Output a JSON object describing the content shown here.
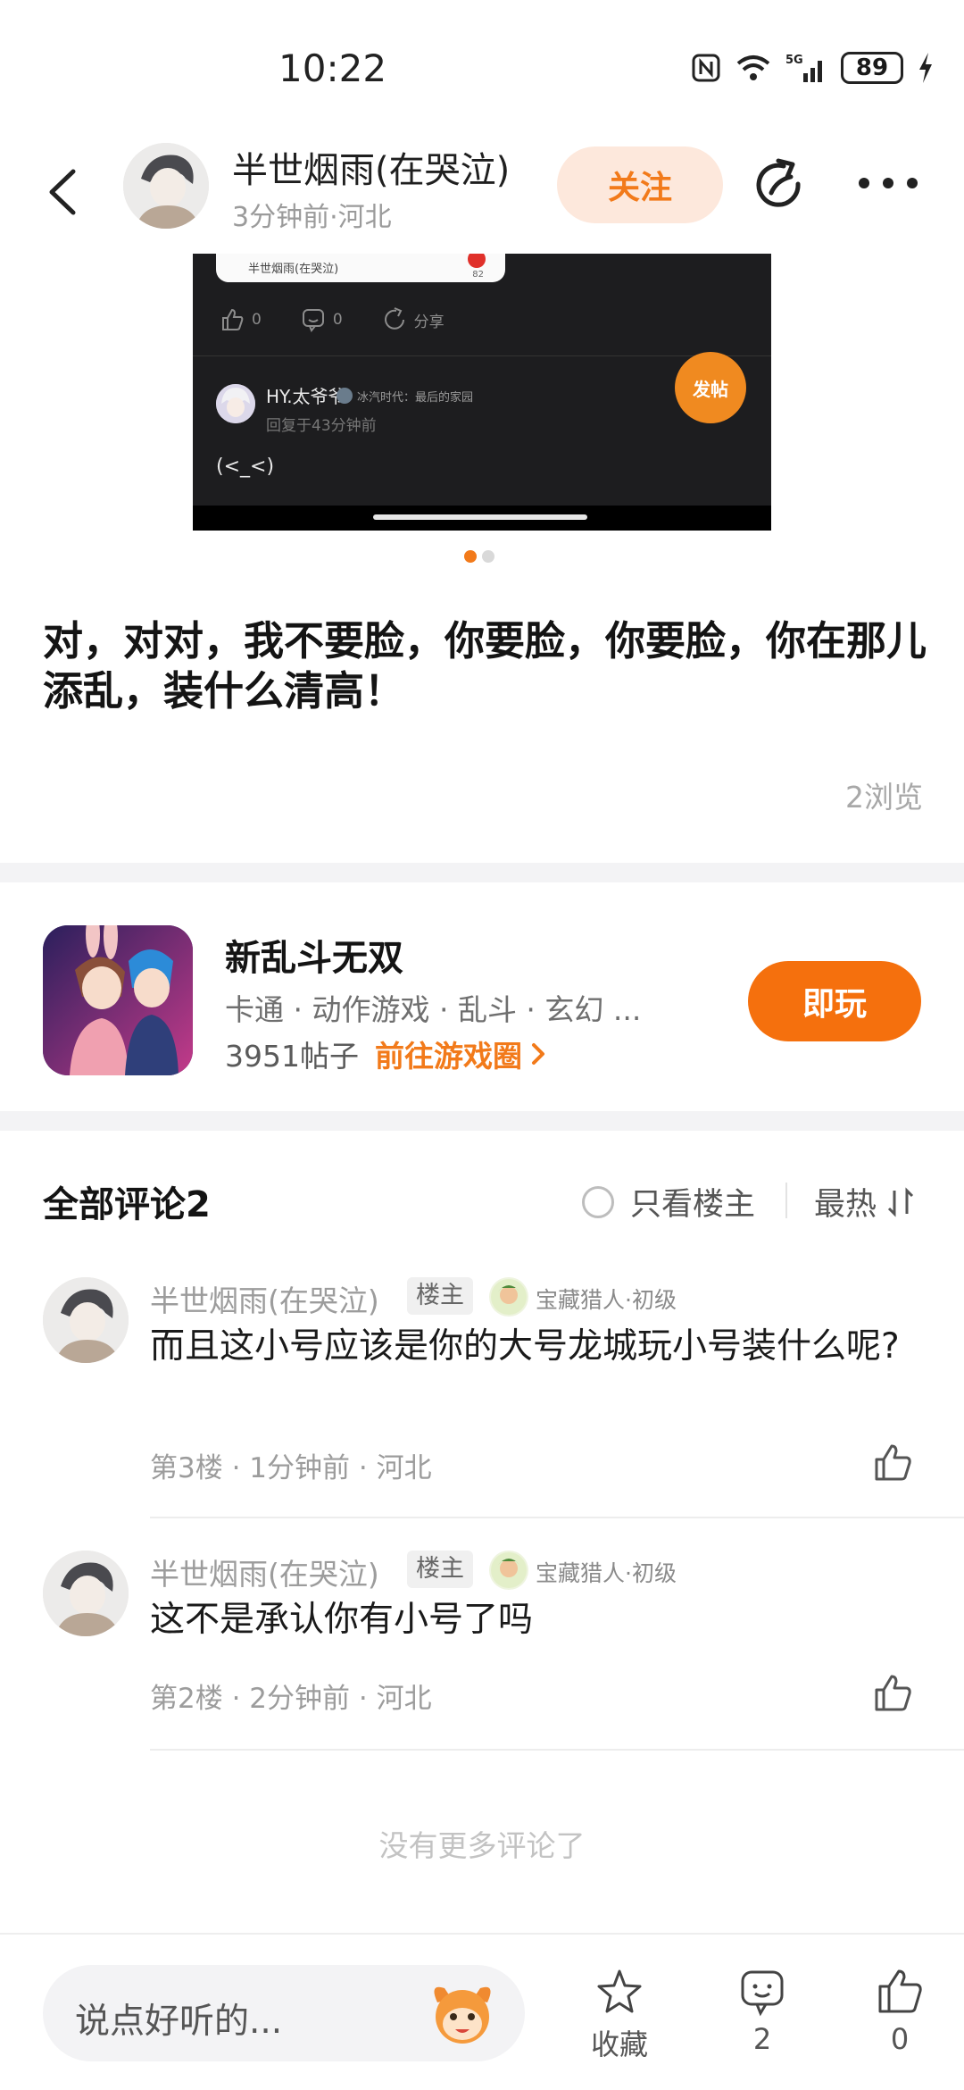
{
  "status_bar": {
    "time": "10:22",
    "battery": "89",
    "network": "5G"
  },
  "header": {
    "author_name": "半世烟雨(在哭泣)",
    "author_meta": "3分钟前·河北",
    "follow_label": "关注"
  },
  "screenshot": {
    "card_text": "半世烟雨(在哭泣)",
    "card_count": "82",
    "like_count": "0",
    "comment_count": "0",
    "share_label": "分享",
    "reply_user": "HY.太爷爷",
    "reply_game": "冰汽时代：最后的家园",
    "reply_time": "回复于43分钟前",
    "reply_text": "(<_<)",
    "fab_label": "发帖",
    "dots": 2,
    "active_dot": 0
  },
  "post": {
    "text": "对，对对，我不要脸，你要脸，你要脸，你在那儿添乱，装什么清高！",
    "views": "2浏览"
  },
  "game": {
    "name": "新乱斗无双",
    "tags": "卡通 · 动作游戏 · 乱斗 · 玄幻 ...",
    "posts": "3951帖子",
    "link_label": "前往游戏圈",
    "play_label": "即玩"
  },
  "comments": {
    "title": "全部评论2",
    "only_op_label": "只看楼主",
    "sort_label": "最热",
    "items": [
      {
        "name": "半世烟雨(在哭泣)",
        "op_tag": "楼主",
        "level": "宝藏猎人·初级",
        "body": "而且这小号应该是你的大号龙城玩小号装什么呢?",
        "meta": "第3楼 · 1分钟前 · 河北"
      },
      {
        "name": "半世烟雨(在哭泣)",
        "op_tag": "楼主",
        "level": "宝藏猎人·初级",
        "body": "这不是承认你有小号了吗",
        "meta": "第2楼 · 2分钟前 · 河北"
      }
    ],
    "no_more": "没有更多评论了"
  },
  "bottom_bar": {
    "input_placeholder": "说点好听的...",
    "collect_label": "收藏",
    "comment_count": "2",
    "like_count": "0"
  },
  "colors": {
    "accent": "#f5700d",
    "follow_bg": "#fde8dc",
    "divider": "#f3f3f5"
  }
}
